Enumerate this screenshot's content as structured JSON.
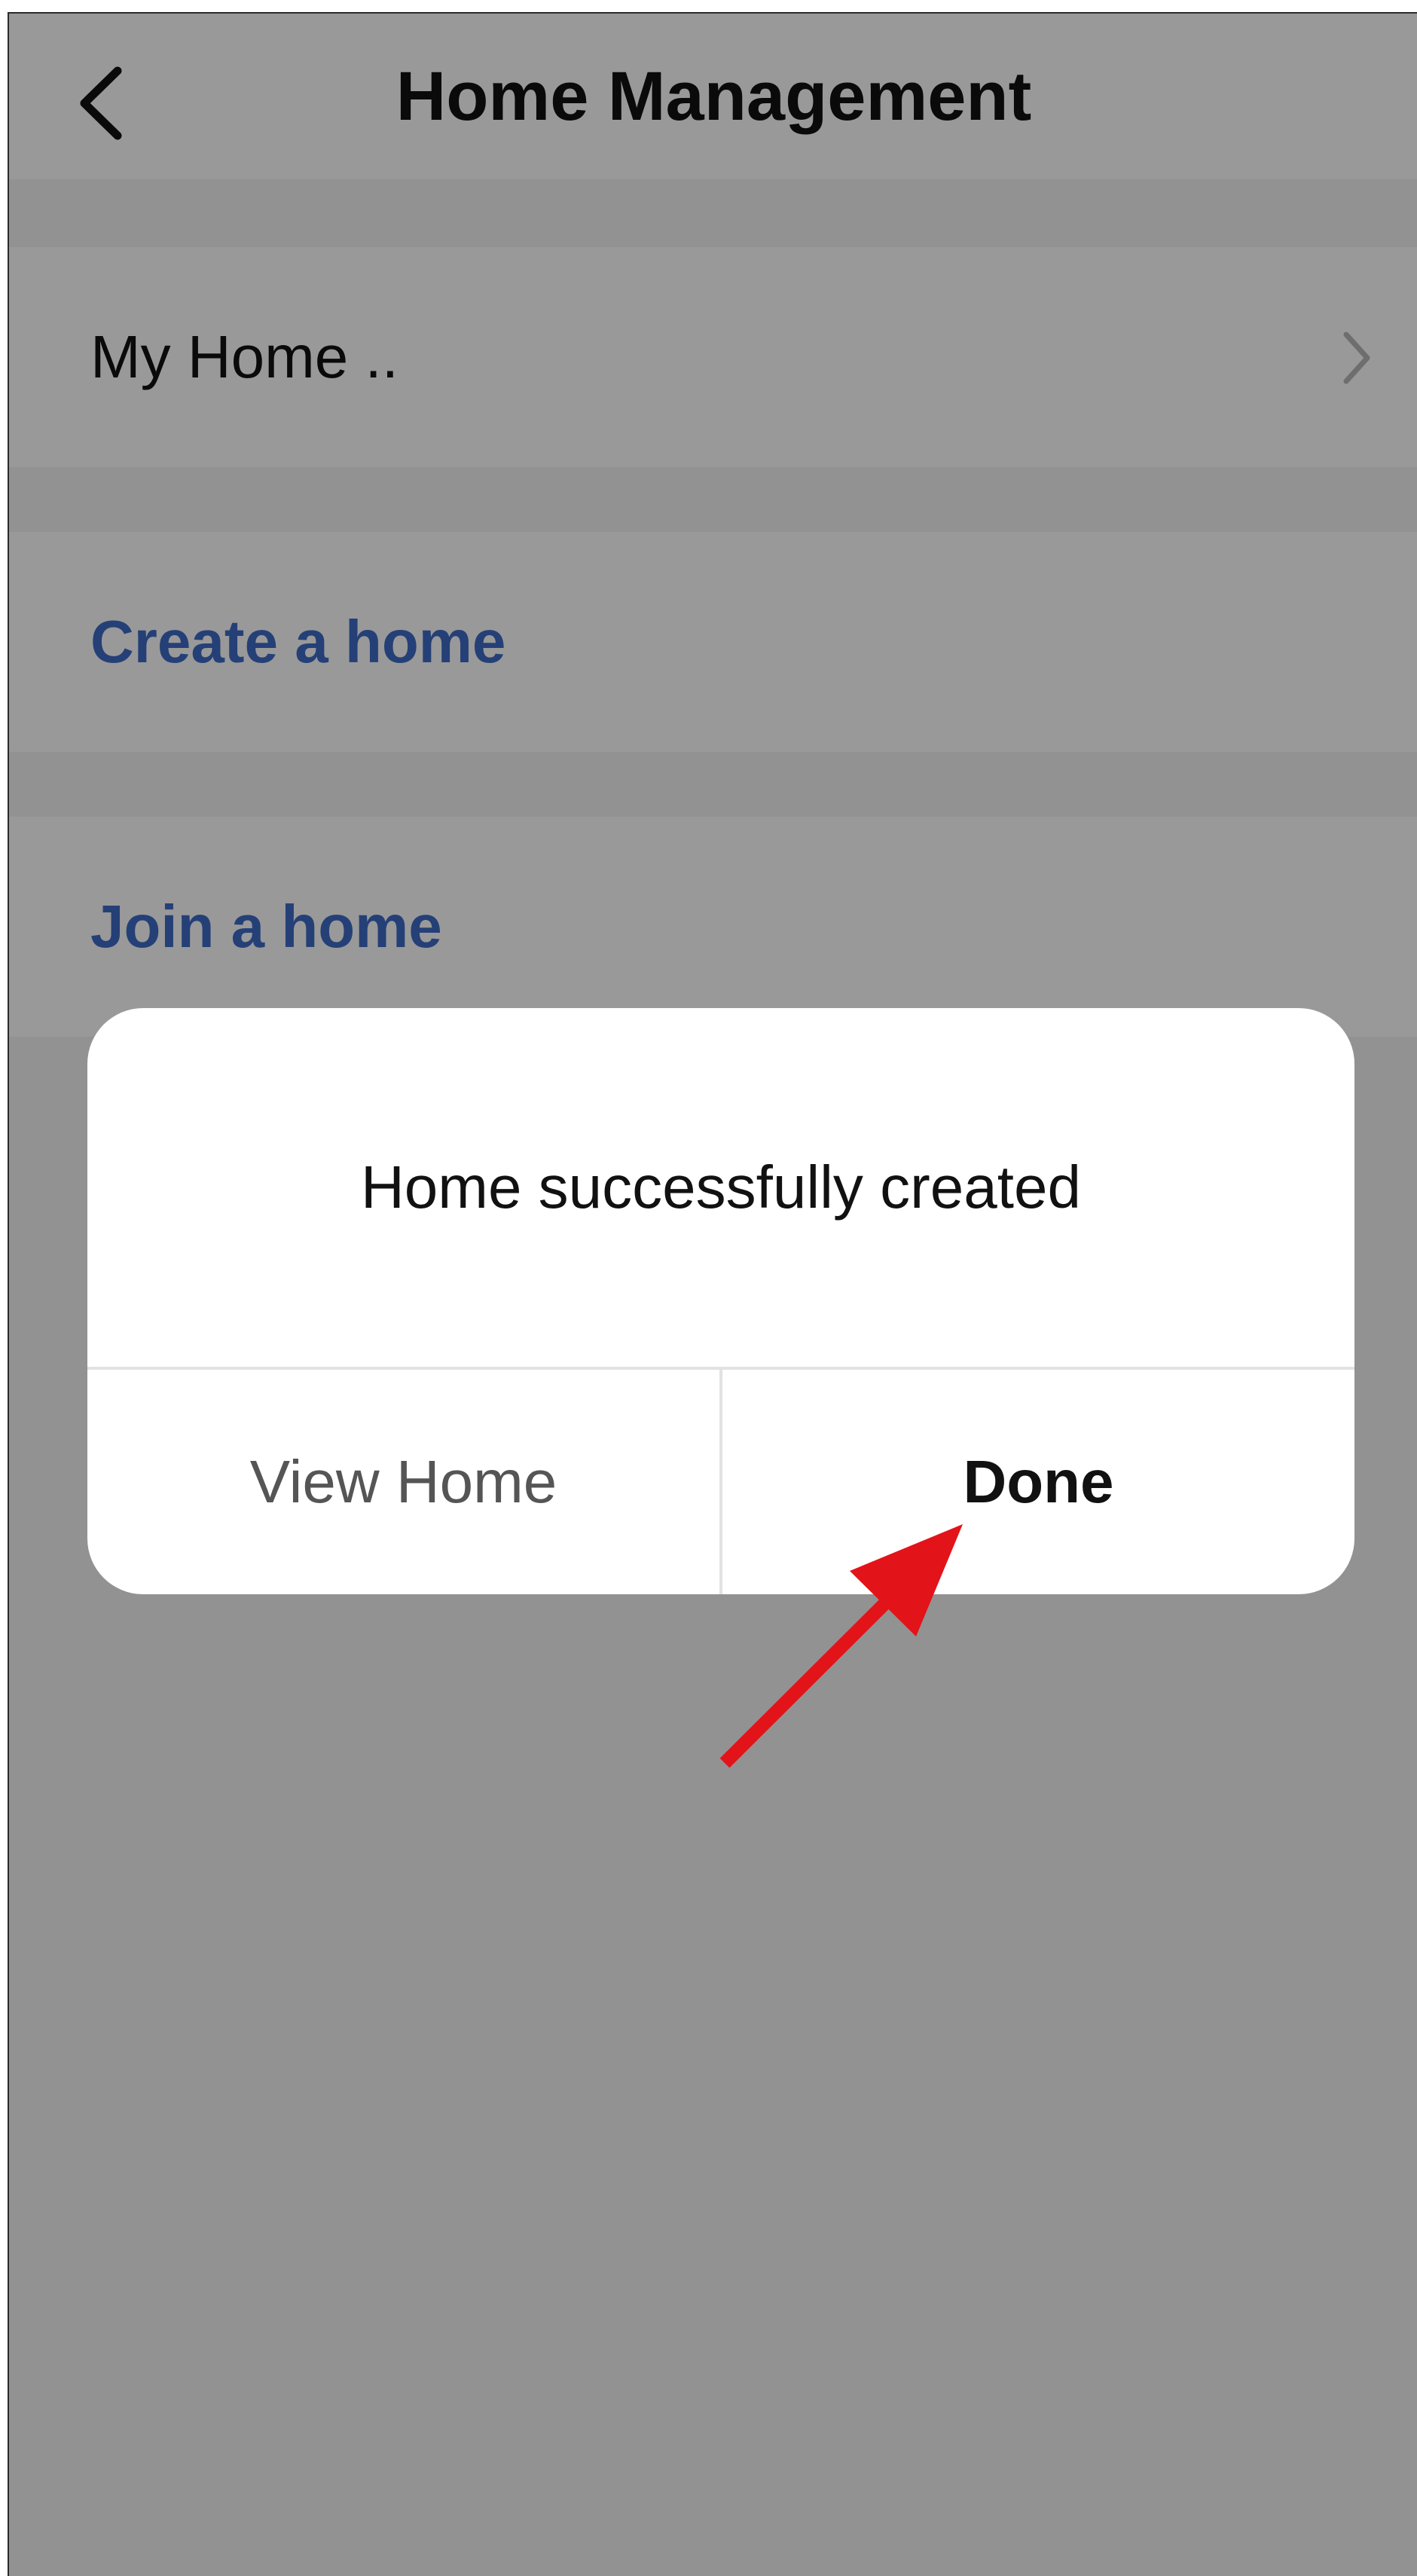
{
  "header": {
    "title": "Home Management",
    "back_icon": "chevron-left-icon"
  },
  "list": {
    "home_item": {
      "label": "My Home ..",
      "icon": "chevron-right-icon"
    },
    "create_home": {
      "label": "Create a home"
    },
    "join_home": {
      "label": "Join a home"
    }
  },
  "dialog": {
    "message": "Home successfully created",
    "view_home_label": "View Home",
    "done_label": "Done"
  },
  "colors": {
    "link": "#3f6cc7",
    "overlay": "rgba(0,0,0,0.40)",
    "annotation_arrow": "#e3131a"
  }
}
